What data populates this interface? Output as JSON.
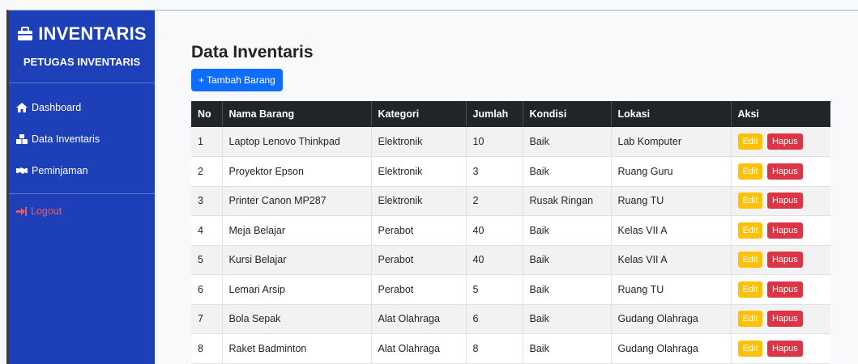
{
  "sidebar": {
    "brand": "INVENTARIS",
    "role": "PETUGAS INVENTARIS",
    "items": [
      {
        "label": "Dashboard",
        "icon": "home-icon"
      },
      {
        "label": "Data Inventaris",
        "icon": "boxes-icon"
      },
      {
        "label": "Peminjaman",
        "icon": "handshake-icon"
      }
    ],
    "logout": "Logout"
  },
  "main": {
    "title": "Data Inventaris",
    "add_button": "+ Tambah Barang",
    "columns": [
      "No",
      "Nama Barang",
      "Kategori",
      "Jumlah",
      "Kondisi",
      "Lokasi",
      "Aksi"
    ],
    "edit_label": "Edit",
    "delete_label": "Hapus",
    "rows": [
      {
        "no": "1",
        "nama": "Laptop Lenovo Thinkpad",
        "kategori": "Elektronik",
        "jumlah": "10",
        "kondisi": "Baik",
        "lokasi": "Lab Komputer"
      },
      {
        "no": "2",
        "nama": "Proyektor Epson",
        "kategori": "Elektronik",
        "jumlah": "3",
        "kondisi": "Baik",
        "lokasi": "Ruang Guru"
      },
      {
        "no": "3",
        "nama": "Printer Canon MP287",
        "kategori": "Elektronik",
        "jumlah": "2",
        "kondisi": "Rusak Ringan",
        "lokasi": "Ruang TU"
      },
      {
        "no": "4",
        "nama": "Meja Belajar",
        "kategori": "Perabot",
        "jumlah": "40",
        "kondisi": "Baik",
        "lokasi": "Kelas VII A"
      },
      {
        "no": "5",
        "nama": "Kursi Belajar",
        "kategori": "Perabot",
        "jumlah": "40",
        "kondisi": "Baik",
        "lokasi": "Kelas VII A"
      },
      {
        "no": "6",
        "nama": "Lemari Arsip",
        "kategori": "Perabot",
        "jumlah": "5",
        "kondisi": "Baik",
        "lokasi": "Ruang TU"
      },
      {
        "no": "7",
        "nama": "Bola Sepak",
        "kategori": "Alat Olahraga",
        "jumlah": "6",
        "kondisi": "Baik",
        "lokasi": "Gudang Olahraga"
      },
      {
        "no": "8",
        "nama": "Raket Badminton",
        "kategori": "Alat Olahraga",
        "jumlah": "8",
        "kondisi": "Baik",
        "lokasi": "Gudang Olahraga"
      }
    ]
  },
  "colors": {
    "sidebar_bg": "#1d3fb8",
    "primary": "#0d6efd",
    "warning": "#ffc107",
    "danger": "#dc3545",
    "table_header": "#212529"
  }
}
